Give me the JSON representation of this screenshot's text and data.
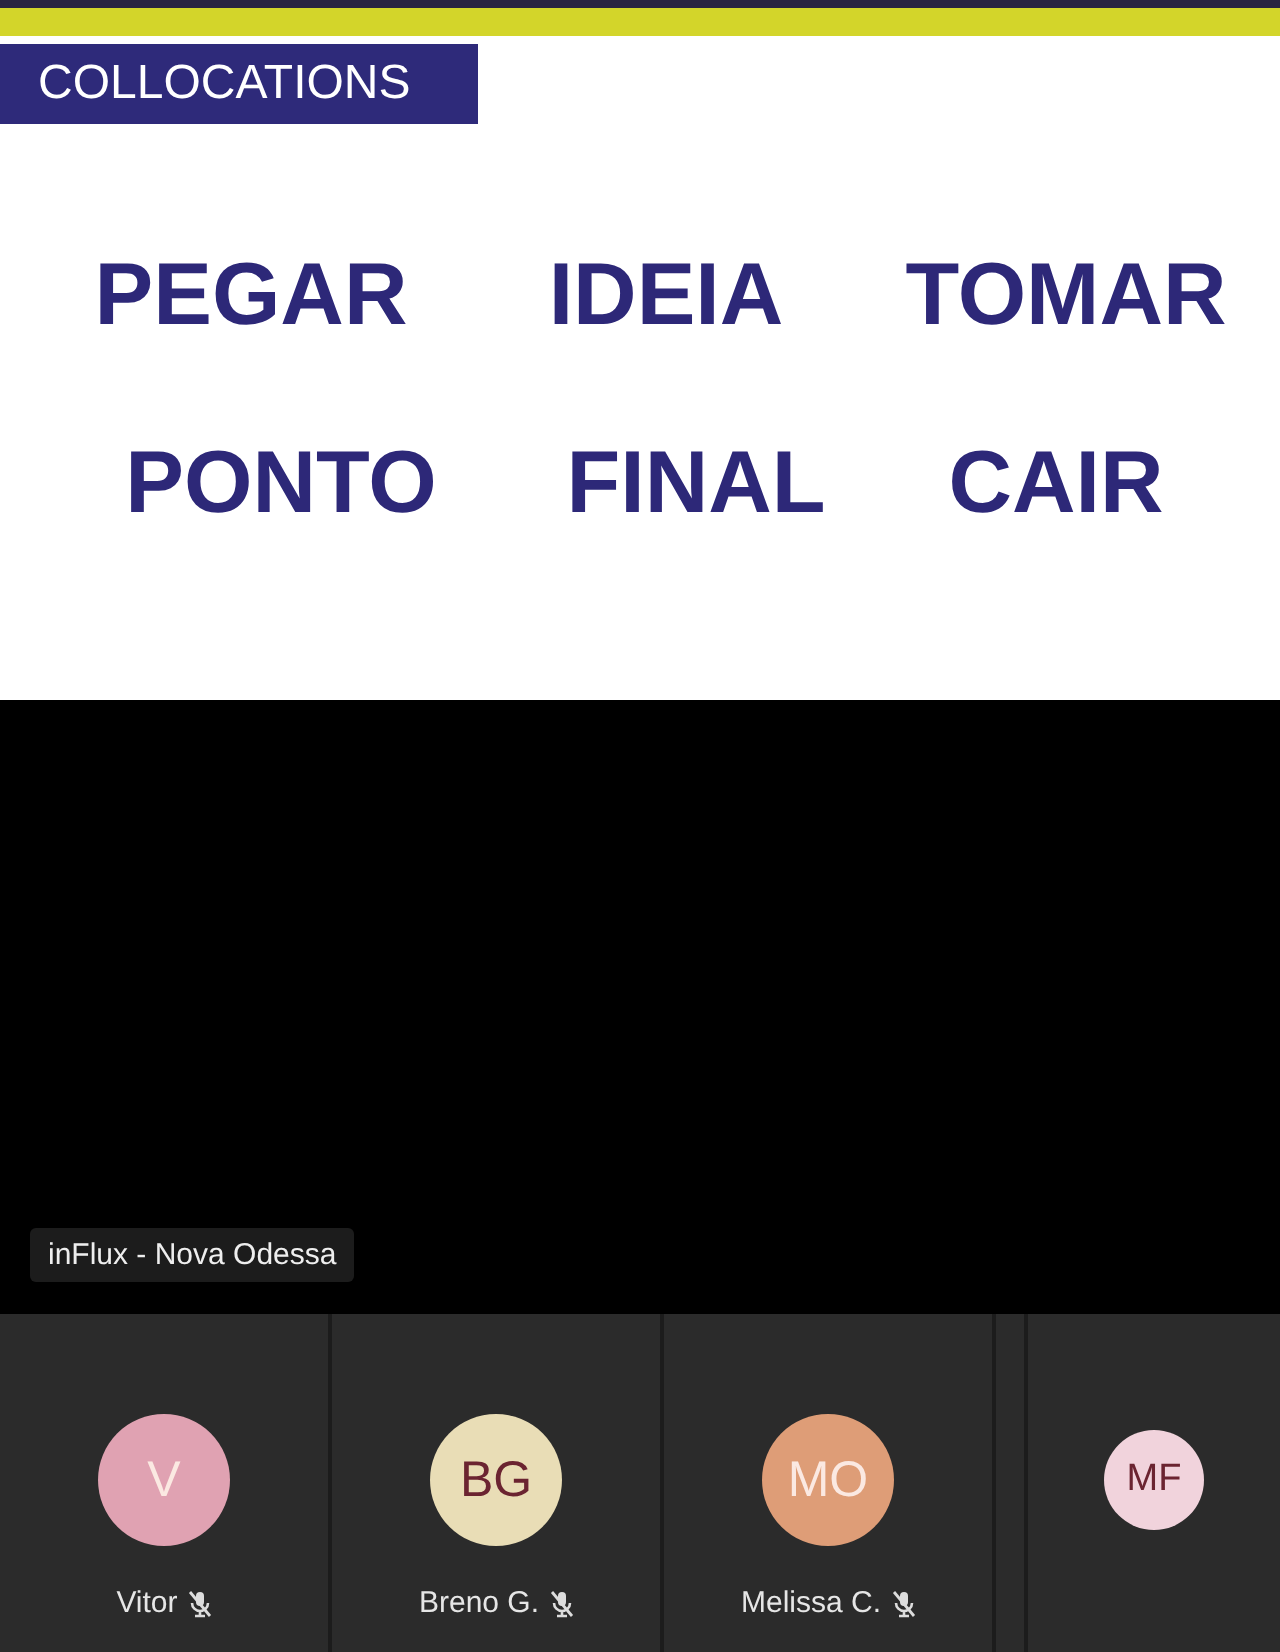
{
  "slide": {
    "title": "COLLOCATIONS",
    "word_rows": [
      [
        "PEGAR",
        "IDEIA",
        "TOMAR"
      ],
      [
        "PONTO",
        "FINAL",
        "CAIR"
      ]
    ]
  },
  "video": {
    "label": "inFlux - Nova Odessa"
  },
  "participants": [
    {
      "kind": "tile",
      "initials": "V",
      "name": "Vitor",
      "muted": true,
      "color": "#e0a2b2"
    },
    {
      "kind": "tile",
      "initials": "BG",
      "name": "Breno G.",
      "muted": true,
      "color": "#e9ddb6"
    },
    {
      "kind": "tile",
      "initials": "MO",
      "name": "Melissa C.",
      "muted": true,
      "color": "#de9d77"
    },
    {
      "kind": "spacer"
    },
    {
      "kind": "small",
      "initials": "MF",
      "color": "#f1d3dc"
    }
  ]
}
